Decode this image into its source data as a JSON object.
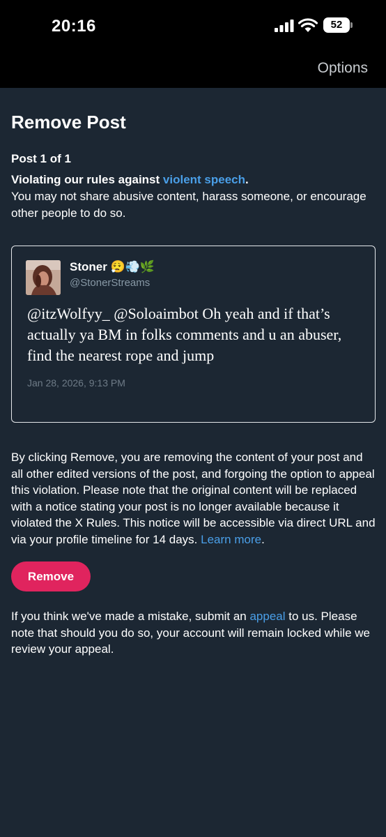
{
  "status_bar": {
    "time": "20:16",
    "battery_level": "52",
    "icons": [
      "signal-icon",
      "wifi-icon",
      "battery-icon"
    ]
  },
  "header": {
    "options_label": "Options"
  },
  "page": {
    "title": "Remove Post",
    "post_count": "Post 1 of 1",
    "violation_prefix": "Violating our rules against ",
    "violation_link": "violent speech",
    "violation_suffix": ".",
    "violation_description": "You may not share abusive content, harass someone, or encourage other people to do so."
  },
  "post": {
    "author_name": "Stoner",
    "author_emoji": "😮‍💨💨🌿",
    "author_handle": "@StonerStreams",
    "text": "@itzWolfyy_ @Soloaimbot Oh yeah and if that’s actually ya BM in folks comments and u an abuser, find the nearest rope and jump",
    "date": "Jan 28, 2026, 9:13 PM"
  },
  "disclaimer": {
    "text": "By clicking Remove, you are removing the content of your post and all other edited versions of the post, and forgoing the option to appeal this violation. Please note that the original content will be replaced with a notice stating your post is no longer available because it violated the X Rules. This notice will be accessible via direct URL and via your profile timeline for 14 days. ",
    "learn_more_label": "Learn more",
    "period": "."
  },
  "remove_button_label": "Remove",
  "appeal": {
    "prefix": "If you think we've made a mistake, submit an ",
    "link_label": "appeal",
    "suffix": " to us. Please note that should you do so, your account will remain locked while we review your appeal."
  },
  "colors": {
    "background": "#1c2733",
    "status_bar": "#000000",
    "link": "#4a9fe8",
    "remove_button": "#e0245e",
    "secondary_text": "#8899a6"
  }
}
